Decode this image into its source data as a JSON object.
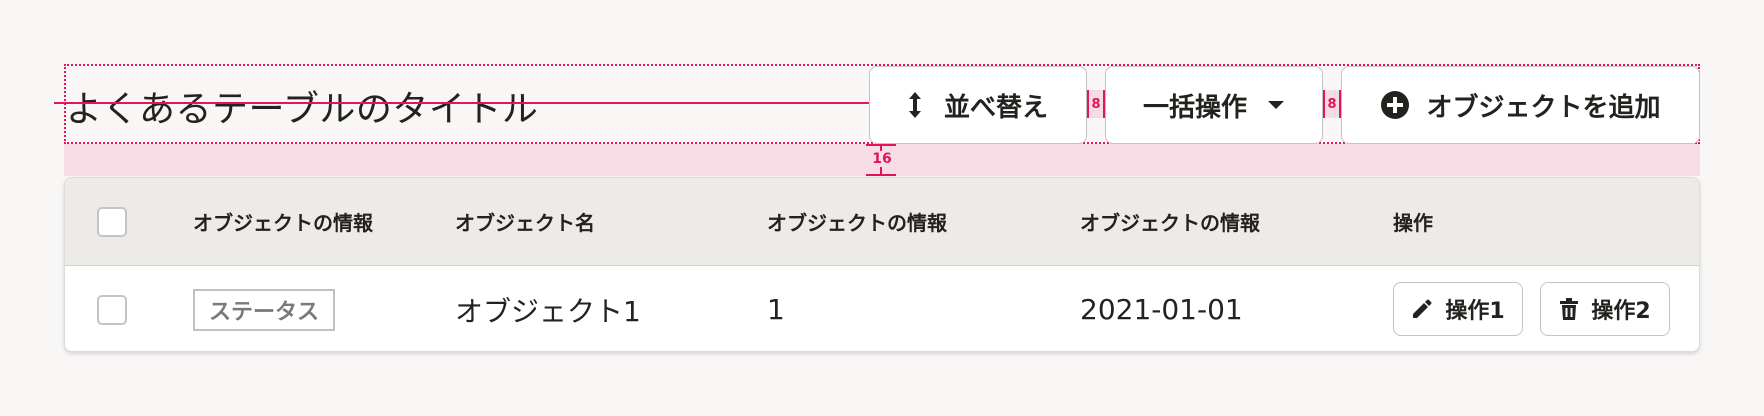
{
  "header": {
    "title": "よくあるテーブルのタイトル",
    "sort_button": {
      "label": "並べ替え",
      "icon": "sort-vertical-icon"
    },
    "bulk_button": {
      "label": "一括操作",
      "icon": "caret-down-icon"
    },
    "add_button": {
      "label": "オブジェクトを追加",
      "icon": "plus-circle-icon"
    }
  },
  "annotations": {
    "button_gap_1": "8",
    "button_gap_2": "8",
    "header_table_gap": "16",
    "guide_color": "#e0155e"
  },
  "table": {
    "columns": [
      "オブジェクトの情報",
      "オブジェクト名",
      "オブジェクトの情報",
      "オブジェクトの情報",
      "操作"
    ],
    "rows": [
      {
        "status": "ステータス",
        "name": "オブジェクト1",
        "info": "1",
        "date": "2021-01-01",
        "action_1": {
          "label": "操作1",
          "icon": "pencil-icon"
        },
        "action_2": {
          "label": "操作2",
          "icon": "trash-icon"
        }
      }
    ]
  },
  "colors": {
    "background": "#f8f7f6",
    "header_row": "#edebe8",
    "accent_guide": "#e0155e"
  }
}
